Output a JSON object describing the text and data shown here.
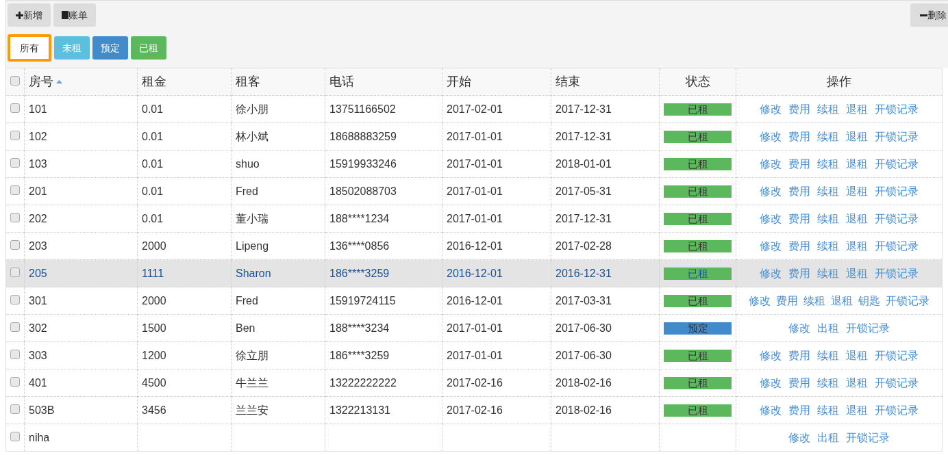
{
  "toolbar": {
    "buttons": [
      {
        "kind": "add",
        "label": "新增"
      },
      {
        "kind": "bill",
        "label": "账单"
      }
    ],
    "delete_button": {
      "label": "删除"
    }
  },
  "filters": [
    {
      "kind": "all",
      "label": "所有",
      "selected": true
    },
    {
      "kind": "vacant",
      "label": "未租",
      "selected": false
    },
    {
      "kind": "reserved",
      "label": "预定",
      "selected": false
    },
    {
      "kind": "rented",
      "label": "已租",
      "selected": false
    }
  ],
  "table": {
    "select_all_checked": false,
    "columns": [
      {
        "label": "房号",
        "sorted": true
      },
      {
        "label": "租金",
        "sorted": false
      },
      {
        "label": "租客",
        "sorted": false
      },
      {
        "label": "电话",
        "sorted": false
      },
      {
        "label": "开始",
        "sorted": false
      },
      {
        "label": "结束",
        "sorted": false
      },
      {
        "label": "状态",
        "sorted": false
      },
      {
        "label": "操作",
        "sorted": false
      }
    ],
    "rows": [
      {
        "checked": false,
        "selected": false,
        "room": "101",
        "rent": "0.01",
        "tenant": "徐小朋",
        "phone": "13751166502",
        "start": "2017-02-01",
        "end": "2017-12-31",
        "status": {
          "kind": "rented",
          "label": "已租"
        },
        "actions": [
          "修改",
          "费用",
          "续租",
          "退租",
          "开锁记录"
        ]
      },
      {
        "checked": false,
        "selected": false,
        "room": "102",
        "rent": "0.01",
        "tenant": "林小斌",
        "phone": "18688883259",
        "start": "2017-01-01",
        "end": "2017-12-31",
        "status": {
          "kind": "rented",
          "label": "已租"
        },
        "actions": [
          "修改",
          "费用",
          "续租",
          "退租",
          "开锁记录"
        ]
      },
      {
        "checked": false,
        "selected": false,
        "room": "103",
        "rent": "0.01",
        "tenant": "shuo",
        "phone": "15919933246",
        "start": "2017-01-01",
        "end": "2018-01-01",
        "status": {
          "kind": "rented",
          "label": "已租"
        },
        "actions": [
          "修改",
          "费用",
          "续租",
          "退租",
          "开锁记录"
        ]
      },
      {
        "checked": false,
        "selected": false,
        "room": "201",
        "rent": "0.01",
        "tenant": "Fred",
        "phone": "18502088703",
        "start": "2017-01-01",
        "end": "2017-05-31",
        "status": {
          "kind": "rented",
          "label": "已租"
        },
        "actions": [
          "修改",
          "费用",
          "续租",
          "退租",
          "开锁记录"
        ]
      },
      {
        "checked": false,
        "selected": false,
        "room": "202",
        "rent": "0.01",
        "tenant": "董小瑞",
        "phone": "188****1234",
        "start": "2017-01-01",
        "end": "2017-12-31",
        "status": {
          "kind": "rented",
          "label": "已租"
        },
        "actions": [
          "修改",
          "费用",
          "续租",
          "退租",
          "开锁记录"
        ]
      },
      {
        "checked": false,
        "selected": false,
        "room": "203",
        "rent": "2000",
        "tenant": "Lipeng",
        "phone": "136****0856",
        "start": "2016-12-01",
        "end": "2017-02-28",
        "status": {
          "kind": "rented",
          "label": "已租"
        },
        "actions": [
          "修改",
          "费用",
          "续租",
          "退租",
          "开锁记录"
        ]
      },
      {
        "checked": false,
        "selected": true,
        "room": "205",
        "rent": "1111",
        "tenant": "Sharon",
        "phone": "186****3259",
        "start": "2016-12-01",
        "end": "2016-12-31",
        "status": {
          "kind": "rented",
          "label": "已租"
        },
        "actions": [
          "修改",
          "费用",
          "续租",
          "退租",
          "开锁记录"
        ]
      },
      {
        "checked": false,
        "selected": false,
        "room": "301",
        "rent": "2000",
        "tenant": "Fred",
        "phone": "15919724115",
        "start": "2016-12-01",
        "end": "2017-03-31",
        "status": {
          "kind": "rented",
          "label": "已租"
        },
        "actions": [
          "修改",
          "费用",
          "续租",
          "退租",
          "钥匙",
          "开锁记录"
        ]
      },
      {
        "checked": false,
        "selected": false,
        "room": "302",
        "rent": "1500",
        "tenant": "Ben",
        "phone": "188****3234",
        "start": "2017-01-01",
        "end": "2017-06-30",
        "status": {
          "kind": "reserved",
          "label": "预定"
        },
        "actions": [
          "修改",
          "出租",
          "开锁记录"
        ]
      },
      {
        "checked": false,
        "selected": false,
        "room": "303",
        "rent": "1200",
        "tenant": "徐立朋",
        "phone": "186****3259",
        "start": "2017-01-01",
        "end": "2017-06-30",
        "status": {
          "kind": "rented",
          "label": "已租"
        },
        "actions": [
          "修改",
          "费用",
          "续租",
          "退租",
          "开锁记录"
        ]
      },
      {
        "checked": false,
        "selected": false,
        "room": "401",
        "rent": "4500",
        "tenant": "牛兰兰",
        "phone": "13222222222",
        "start": "2017-02-16",
        "end": "2018-02-16",
        "status": {
          "kind": "rented",
          "label": "已租"
        },
        "actions": [
          "修改",
          "费用",
          "续租",
          "退租",
          "开锁记录"
        ]
      },
      {
        "checked": false,
        "selected": false,
        "room": "503B",
        "rent": "3456",
        "tenant": "兰兰安",
        "phone": "1322213131",
        "start": "2017-02-16",
        "end": "2018-02-16",
        "status": {
          "kind": "rented",
          "label": "已租"
        },
        "actions": [
          "修改",
          "费用",
          "续租",
          "退租",
          "开锁记录"
        ]
      },
      {
        "checked": false,
        "selected": false,
        "room": "niha",
        "actions": [
          "修改",
          "出租",
          "开锁记录"
        ]
      }
    ]
  }
}
